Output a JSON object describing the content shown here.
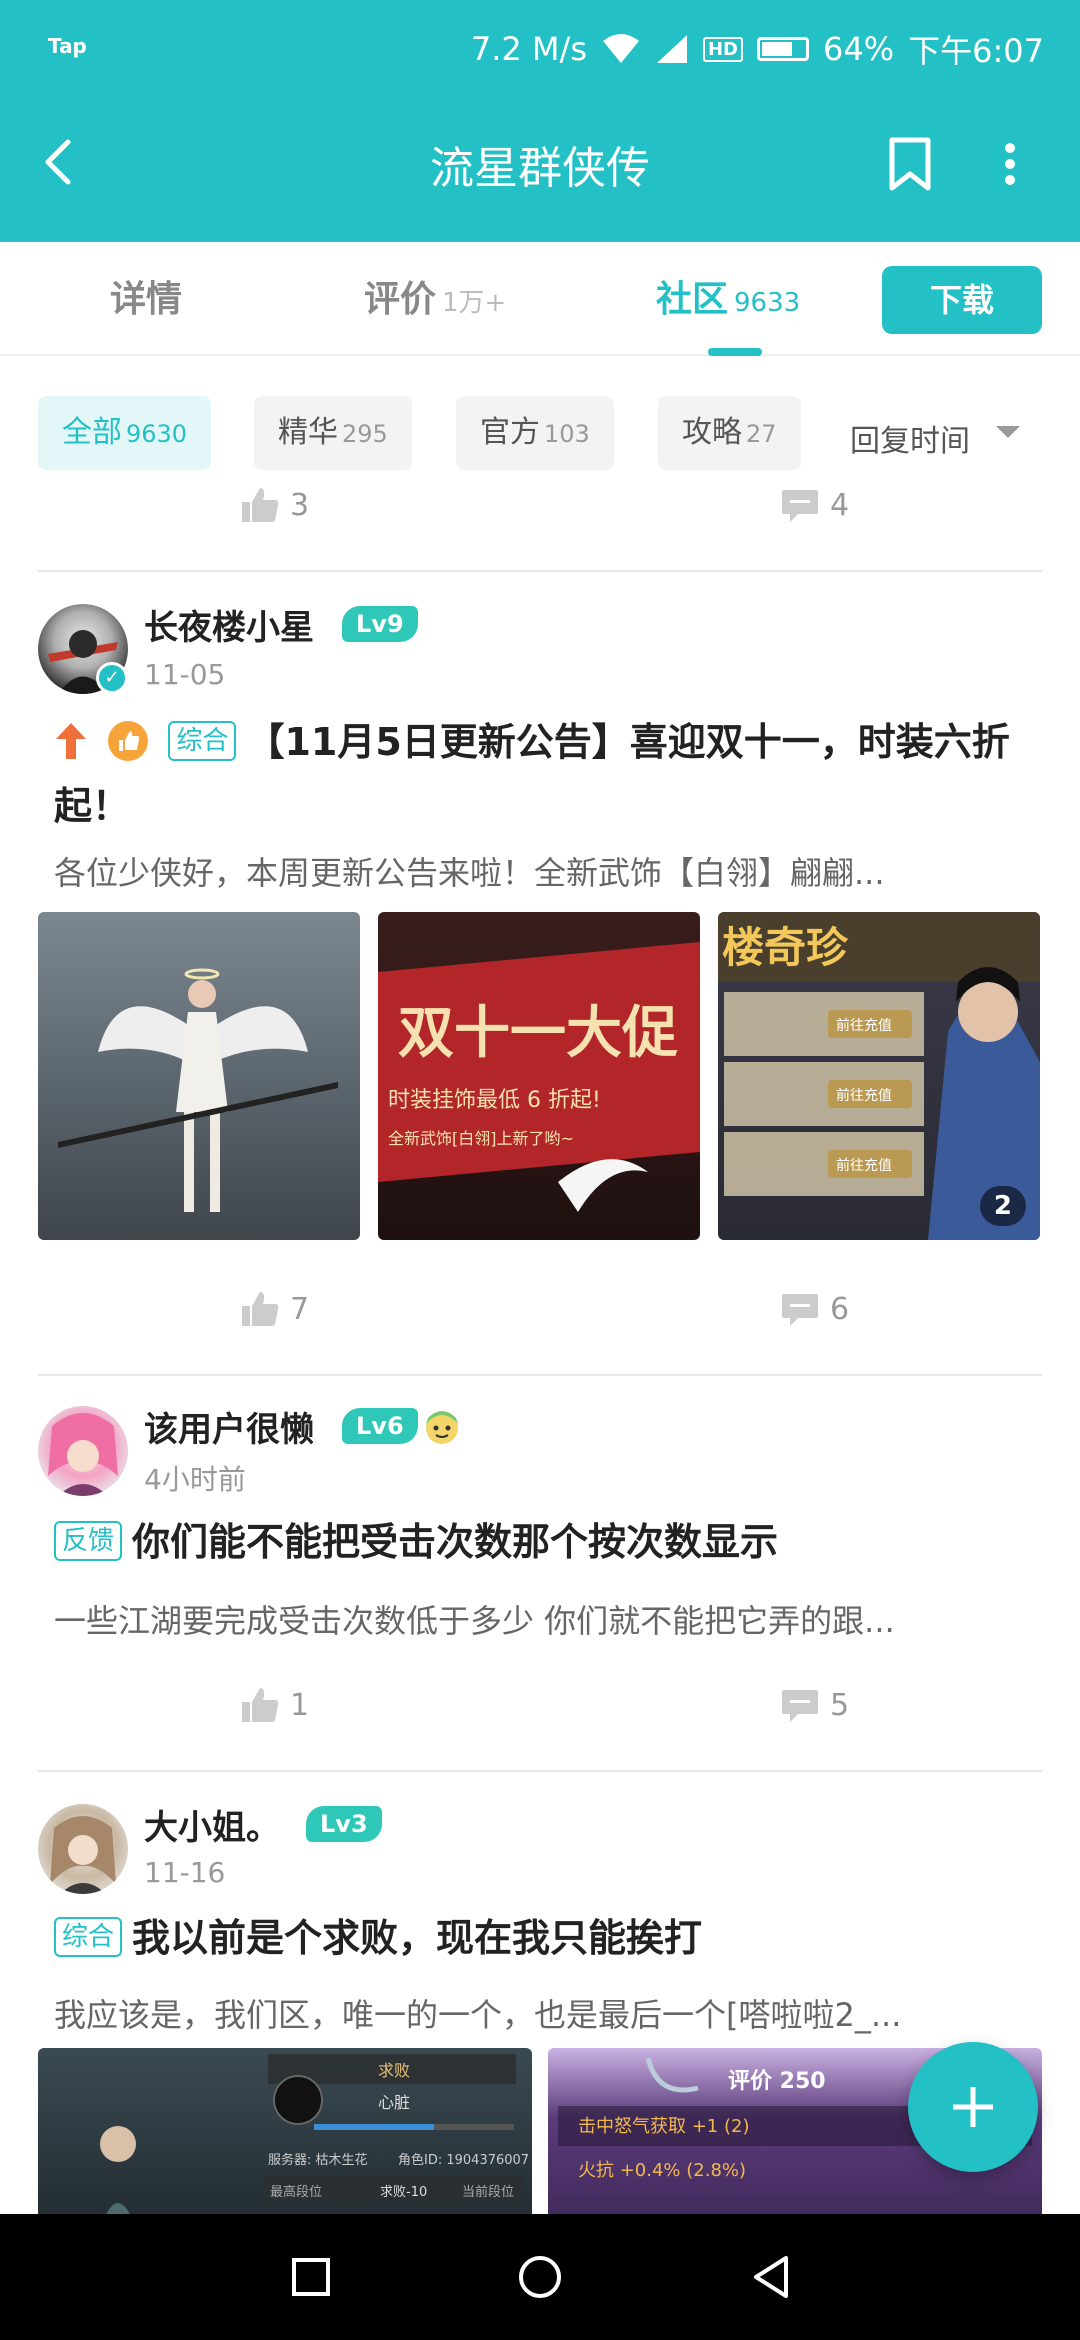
{
  "status_bar": {
    "carrier_label": "Tap",
    "speed": "7.2 M/s",
    "hd_label": "HD",
    "battery": "64%",
    "time": "下午6:07"
  },
  "app_bar": {
    "title": "流星群侠传"
  },
  "tabs": [
    {
      "label": "详情",
      "count": ""
    },
    {
      "label": "评价",
      "count": "1万+"
    },
    {
      "label": "社区",
      "count": "9633"
    }
  ],
  "download_label": "下载",
  "filters": [
    {
      "label": "全部",
      "count": "9630"
    },
    {
      "label": "精华",
      "count": "295"
    },
    {
      "label": "官方",
      "count": "103"
    },
    {
      "label": "攻略",
      "count": "27"
    }
  ],
  "sort_label": "回复时间",
  "previous_post": {
    "likes": "3",
    "comments": "4"
  },
  "posts": [
    {
      "username": "长夜楼小星",
      "level": "Lv9",
      "time": "11-05",
      "tag": "综合",
      "title": "【11月5日更新公告】喜迎双十一，时装六折起！",
      "excerpt": "各位少侠好，本周更新公告来啦！全新武饰【白翎】翩翩...",
      "image_text_1": "双十一大促",
      "image_text_2": "时装挂饰最低 6 折起!",
      "image_text_3": "全新武饰[白翎]上新了哟~",
      "image_text_4": "楼奇珍",
      "image_btn": "前往充值",
      "image_more": "2",
      "likes": "7",
      "comments": "6"
    },
    {
      "username": "该用户很懒",
      "level": "Lv6",
      "time": "4小时前",
      "tag": "反馈",
      "title": "你们能不能把受击次数那个按次数显示",
      "excerpt": "一些江湖要完成受击次数低于多少 你们就不能把它弄的跟...",
      "likes": "1",
      "comments": "5"
    },
    {
      "username": "大小姐。",
      "level": "Lv3",
      "time": "11-16",
      "tag": "综合",
      "title": "我以前是个求败，现在我只能挨打",
      "excerpt": "我应该是，我们区，唯一的一个，也是最后一个[嗒啦啦2_...",
      "img_rank": "求败",
      "img_name": "心脏",
      "img_server": "服务器: 枯木生花",
      "img_role_id": "角色ID: 1904376007",
      "img_highest": "最高段位",
      "img_rank2": "求败-10",
      "img_current": "当前段位",
      "img_score": "评价 250",
      "img_stat1": "击中怒气获取 +1 (2)",
      "img_stat2": "火抗 +0.4% (2.8%)"
    }
  ],
  "colors": {
    "accent": "#23c0c6",
    "level_badge": "#2fc7b8"
  }
}
